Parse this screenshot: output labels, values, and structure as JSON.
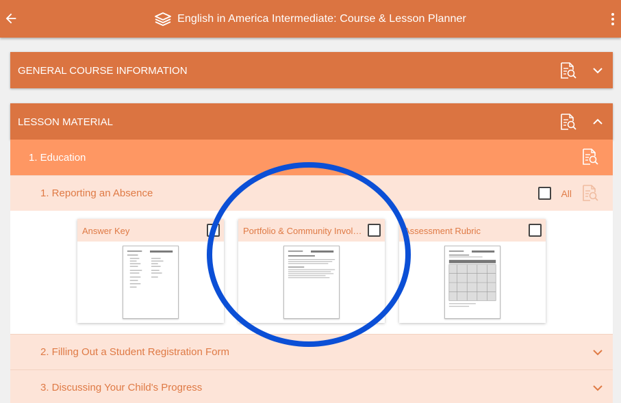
{
  "app": {
    "title": "English in America Intermediate: Course & Lesson Planner"
  },
  "sections": {
    "general": {
      "label": "GENERAL COURSE INFORMATION"
    },
    "lesson_material": {
      "label": "LESSON MATERIAL"
    }
  },
  "unit": {
    "label": "1. Education"
  },
  "lessons": [
    {
      "label": "1. Reporting an Absence",
      "all_label": "All"
    },
    {
      "label": "2. Filling Out a Student Registration Form"
    },
    {
      "label": "3. Discussing Your Child's Progress"
    }
  ],
  "materials": [
    {
      "title": "Answer Key"
    },
    {
      "title": "Portfolio & Community Involvement"
    },
    {
      "title": "Assessment Rubric"
    }
  ],
  "colors": {
    "accent": "#db7441",
    "unit": "#fe9763",
    "lesson": "#fde4d8",
    "highlight_circle": "#0b4fd6"
  }
}
